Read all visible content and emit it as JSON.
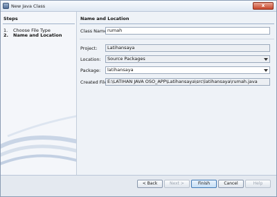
{
  "window": {
    "title": "New Java Class",
    "close_glyph": "x"
  },
  "steps": {
    "title": "Steps",
    "items": [
      {
        "num": "1.",
        "label": "Choose File Type"
      },
      {
        "num": "2.",
        "label": "Name and Location"
      }
    ]
  },
  "form": {
    "section_title": "Name and Location",
    "class_name": {
      "label": "Class Name:",
      "value": "rumah"
    },
    "project": {
      "label": "Project:",
      "value": "Latihansaya"
    },
    "location": {
      "label": "Location:",
      "value": "Source Packages"
    },
    "package": {
      "label": "Package:",
      "value": "latihansaya"
    },
    "created_file": {
      "label": "Created File:",
      "value": "E:\\LATIHAN JAVA OSO_APP\\Latihansaya\\src\\latihansaya\\rumah.java"
    }
  },
  "buttons": {
    "back": "< Back",
    "next": "Next >",
    "finish": "Finish",
    "cancel": "Cancel",
    "help": "Help"
  },
  "icons": {
    "app": "java-class-wizard-icon",
    "close": "close-icon",
    "dropdown": "chevron-down-icon"
  },
  "colors": {
    "accent": "#3f78b5",
    "close": "#c7462b",
    "panel": "#eef2f7"
  }
}
